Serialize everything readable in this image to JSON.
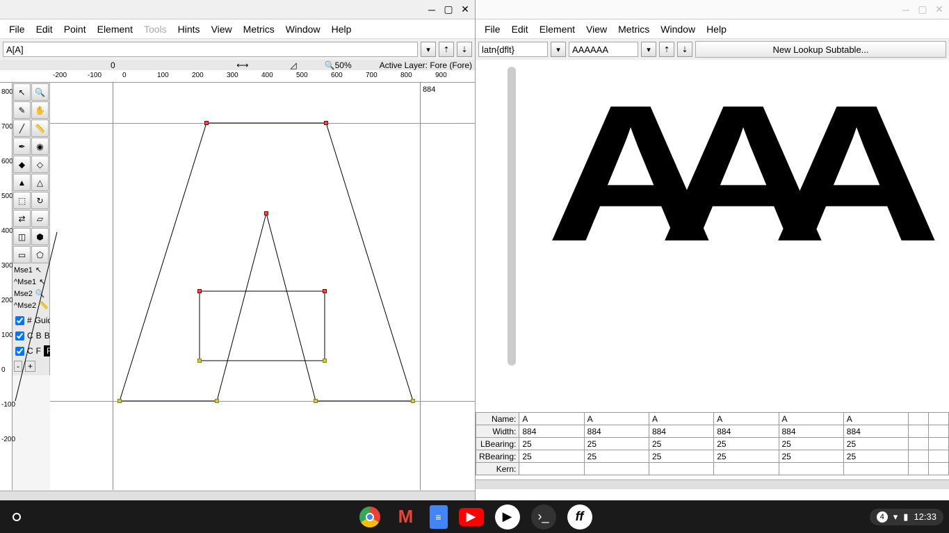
{
  "left": {
    "menus": [
      "File",
      "Edit",
      "Point",
      "Element",
      "Tools",
      "Hints",
      "View",
      "Metrics",
      "Window",
      "Help"
    ],
    "glyph_field": "A[A]",
    "zoom": "50%",
    "active_layer": "Active Layer: Fore (Fore)",
    "advance_width": "884",
    "ruler_x": [
      "-200",
      "-100",
      "0",
      "100",
      "200",
      "300",
      "400",
      "500",
      "600",
      "700",
      "800",
      "900"
    ],
    "ruler_y": [
      "800",
      "700",
      "600",
      "500",
      "400",
      "300",
      "200",
      "100",
      "0",
      "-100",
      "-200"
    ],
    "mouse": [
      "Mse1",
      "^Mse1",
      "Mse2",
      "^Mse2"
    ],
    "layers": {
      "header": [
        "#",
        "Guide"
      ],
      "rows": [
        {
          "c": "C",
          "b": "B",
          "name": "Back"
        },
        {
          "c": "C",
          "b": "F",
          "name": "Fore",
          "sel": true
        }
      ]
    }
  },
  "right": {
    "menus": [
      "File",
      "Edit",
      "Element",
      "View",
      "Metrics",
      "Window",
      "Help"
    ],
    "script": "latn{dflt}",
    "text": "AAAAAA",
    "lookup_btn": "New Lookup Subtable...",
    "metrics": {
      "rows": [
        "Name:",
        "Width:",
        "LBearing:",
        "RBearing:",
        "Kern:"
      ],
      "cols": 6,
      "data": {
        "Name:": [
          "A",
          "A",
          "A",
          "A",
          "A",
          "A"
        ],
        "Width:": [
          "884",
          "884",
          "884",
          "884",
          "884",
          "884"
        ],
        "LBearing:": [
          "25",
          "25",
          "25",
          "25",
          "25",
          "25"
        ],
        "RBearing:": [
          "25",
          "25",
          "25",
          "25",
          "25",
          "25"
        ],
        "Kern:": [
          "",
          "",
          "",
          "",
          "",
          ""
        ]
      }
    }
  },
  "taskbar": {
    "notif": "4",
    "clock": "12:33"
  }
}
